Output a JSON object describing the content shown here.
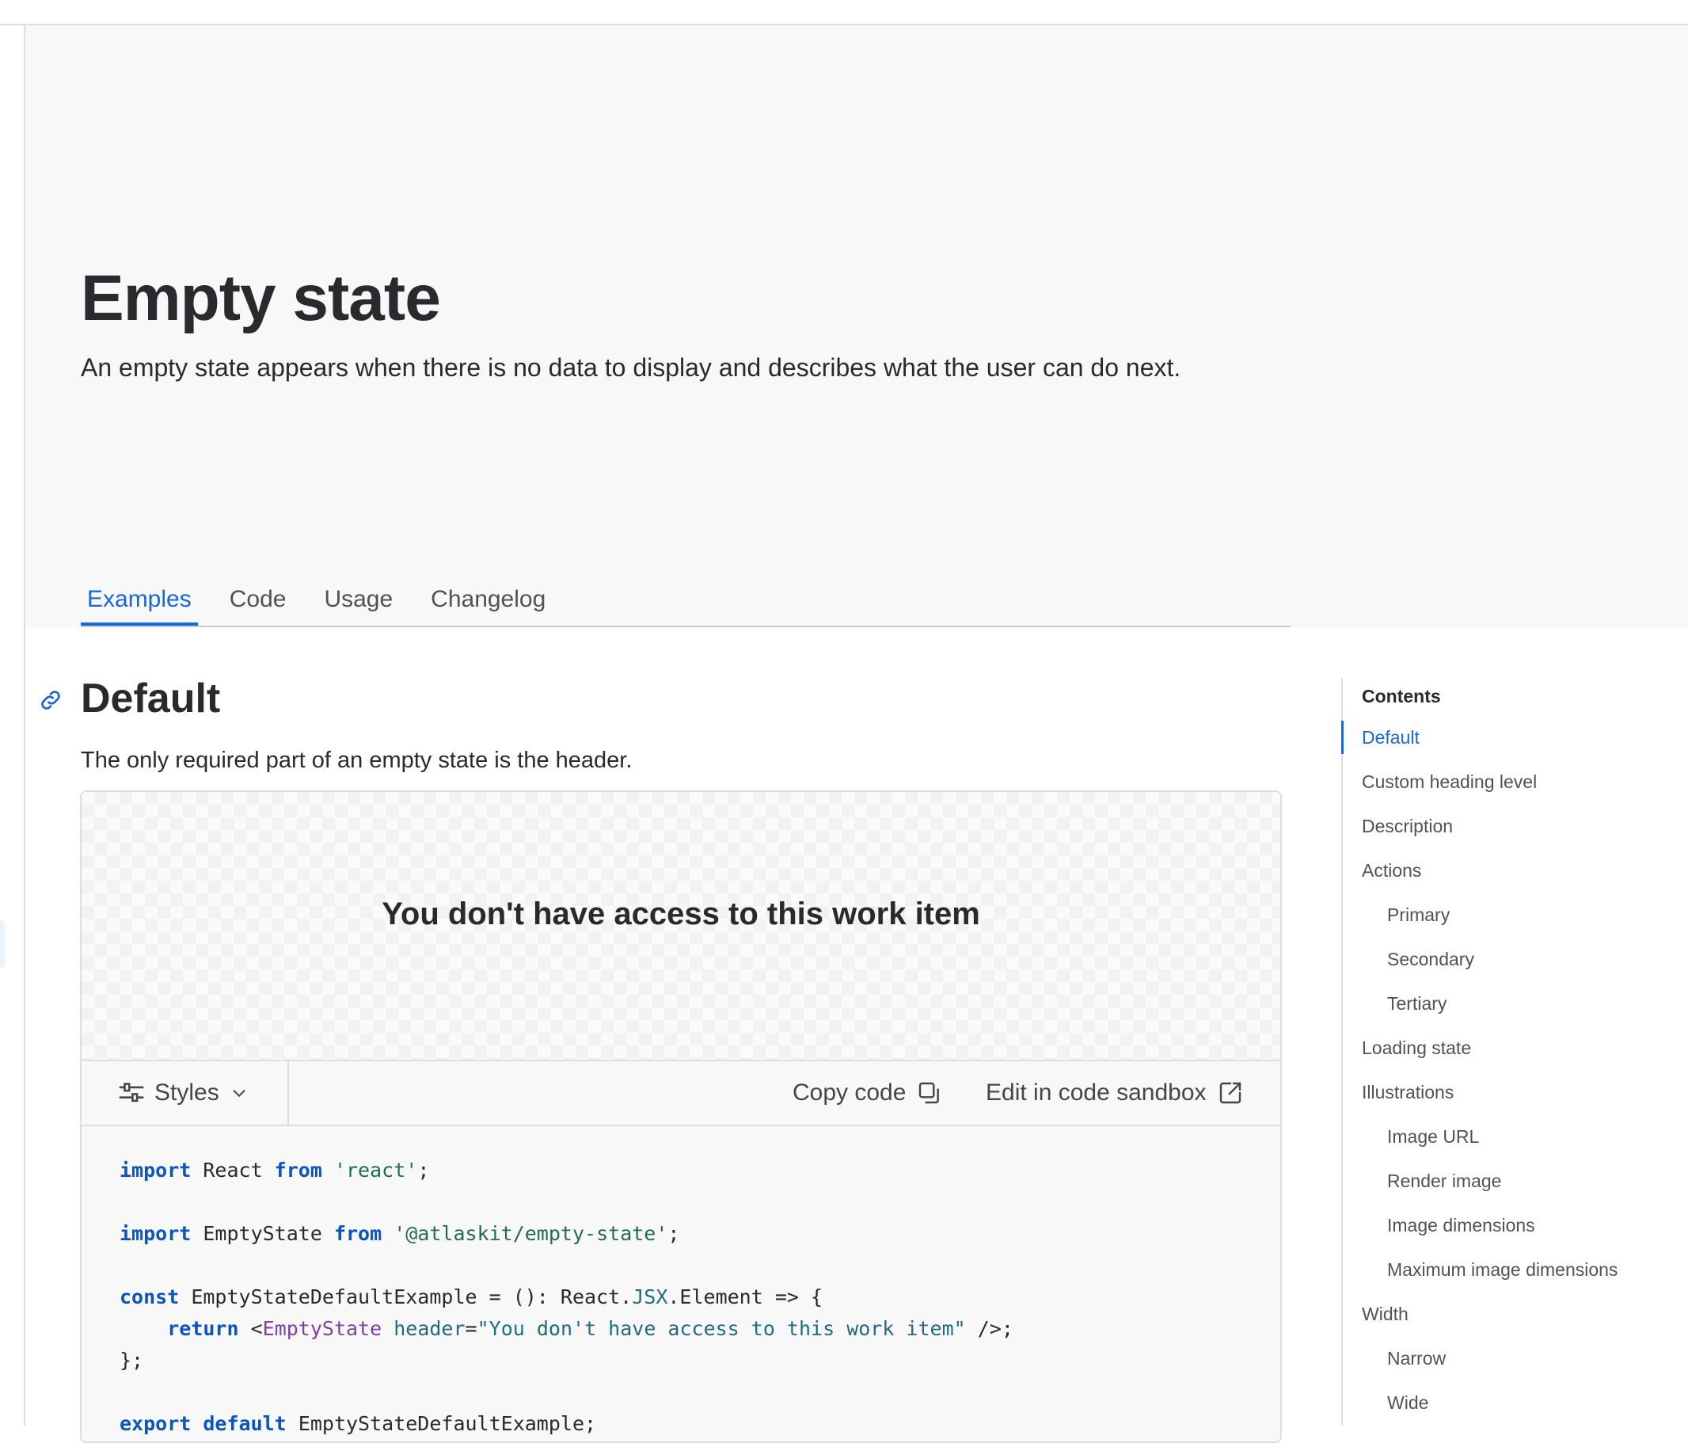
{
  "header": {
    "title": "Empty state",
    "description": "An empty state appears when there is no data to display and describes what the user can do next."
  },
  "tabs": [
    {
      "label": "Examples",
      "active": true
    },
    {
      "label": "Code",
      "active": false
    },
    {
      "label": "Usage",
      "active": false
    },
    {
      "label": "Changelog",
      "active": false
    }
  ],
  "section": {
    "title": "Default",
    "description": "The only required part of an empty state is the header."
  },
  "example": {
    "preview_heading": "You don't have access to this work item",
    "toolbar": {
      "styles_label": "Styles",
      "copy_label": "Copy code",
      "sandbox_label": "Edit in code sandbox"
    },
    "code_lines": [
      "import React from 'react';",
      "",
      "import EmptyState from '@atlaskit/empty-state';",
      "",
      "const EmptyStateDefaultExample = (): React.JSX.Element => {",
      "\treturn <EmptyState header=\"You don't have access to this work item\" />;",
      "};",
      "",
      "export default EmptyStateDefaultExample;"
    ]
  },
  "toc": {
    "title": "Contents",
    "items": [
      {
        "label": "Default",
        "level": 1,
        "active": true
      },
      {
        "label": "Custom heading level",
        "level": 1
      },
      {
        "label": "Description",
        "level": 1
      },
      {
        "label": "Actions",
        "level": 1
      },
      {
        "label": "Primary",
        "level": 2
      },
      {
        "label": "Secondary",
        "level": 2
      },
      {
        "label": "Tertiary",
        "level": 2
      },
      {
        "label": "Loading state",
        "level": 1
      },
      {
        "label": "Illustrations",
        "level": 1
      },
      {
        "label": "Image URL",
        "level": 2
      },
      {
        "label": "Render image",
        "level": 2
      },
      {
        "label": "Image dimensions",
        "level": 2
      },
      {
        "label": "Maximum image dimensions",
        "level": 2
      },
      {
        "label": "Width",
        "level": 1
      },
      {
        "label": "Narrow",
        "level": 2
      },
      {
        "label": "Wide",
        "level": 2
      }
    ]
  },
  "colors": {
    "accent": "#1868db",
    "text": "#292a2e",
    "subtle_text": "#505258",
    "hero_bg": "#f8f8f8"
  }
}
